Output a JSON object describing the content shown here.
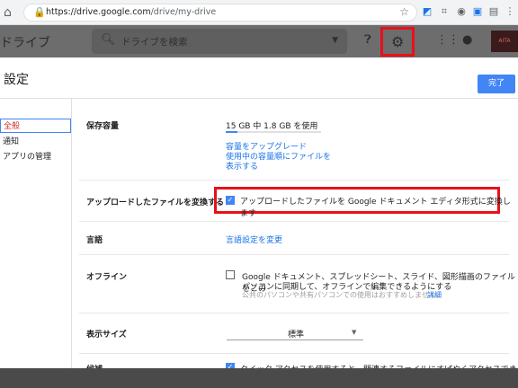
{
  "browser": {
    "url_host": "https://drive.google.com",
    "url_path": "/drive/my-drive",
    "home_icon": "home-icon",
    "lock_icon": "lock-icon"
  },
  "drive_header": {
    "logo_text": "ドライブ",
    "search_placeholder": "ドライブを検索",
    "avatar_text": "AITA"
  },
  "settings": {
    "title": "設定",
    "done_label": "完了"
  },
  "nav": {
    "items": [
      "全般",
      "通知",
      "アプリの管理"
    ]
  },
  "storage": {
    "label": "保存容量",
    "usage": "15 GB 中 1.8 GB を使用",
    "used_fraction": 0.12,
    "upgrade_link": "容量をアップグレード",
    "view_items_link_1": "使用中の容量順にファイルを",
    "view_items_link_2": "表示する"
  },
  "convert": {
    "label": "アップロードしたファイルを変換する",
    "checkbox_text": "アップロードしたファイルを Google ドキュメント エディタ形式に変換します",
    "checked": true
  },
  "language": {
    "label": "言語",
    "link": "言語設定を変更"
  },
  "offline": {
    "label": "オフライン",
    "line1": "Google ドキュメント、スプレッドシート、スライド、図形描画のファイルをこの",
    "line2": "パソコンに同期して、オフラインで編集できるようにする",
    "note": "公共のパソコンや共有パソコンでの使用はおすすめしません。",
    "details_link": "詳細",
    "checked": false
  },
  "density": {
    "label": "表示サイズ",
    "value": "標準"
  },
  "suggestions": {
    "label": "候補",
    "text": "クイック アクセスを使用すると、関連するファイルにすばやくアクセスできるよ"
  },
  "colors": {
    "accent": "#4285f4",
    "highlight": "#e8101a",
    "link": "#1a73e8"
  }
}
